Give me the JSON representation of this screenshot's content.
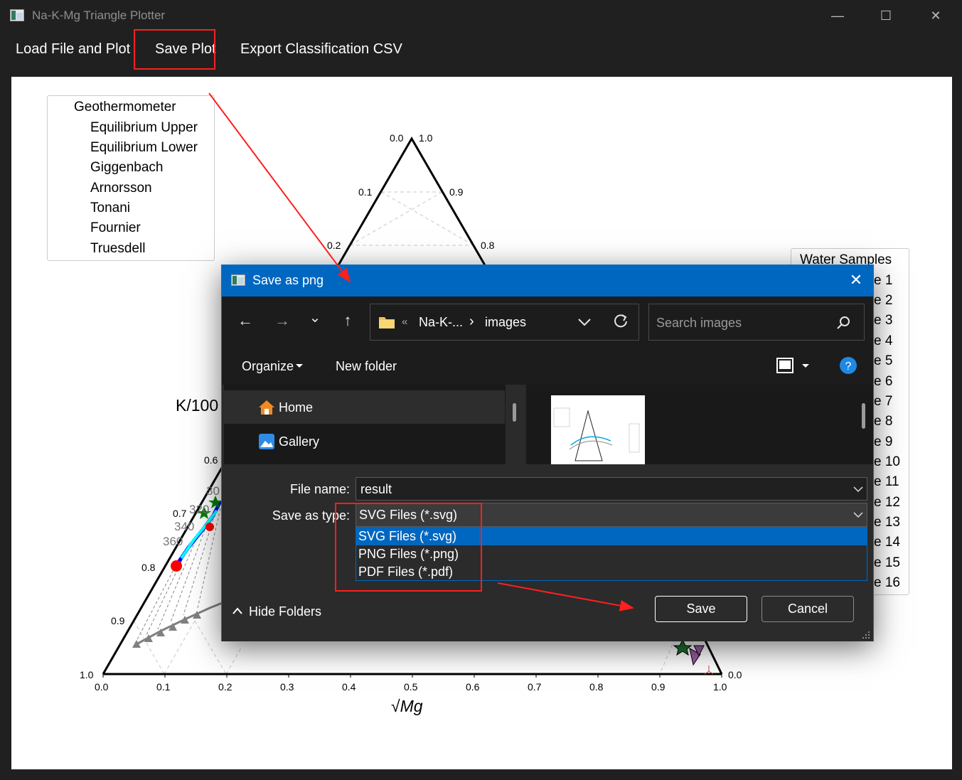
{
  "window": {
    "title": "Na-K-Mg Triangle Plotter",
    "controls": {
      "minimize": "—",
      "maximize": "☐",
      "close": "✕"
    }
  },
  "menu": {
    "load": "Load File and Plot",
    "save": "Save Plot",
    "export": "Export Classification CSV"
  },
  "legend": {
    "title": "Geothermometer",
    "items": [
      {
        "label": "Equilibrium Upper",
        "color": "#808080",
        "marker": "circle"
      },
      {
        "label": "Equilibrium Lower",
        "color": "#808080",
        "marker": "triangle-up"
      },
      {
        "label": "Giggenbach",
        "color": "#000000",
        "marker": "triangle-up"
      },
      {
        "label": "Arnorsson",
        "color": "#ff0000",
        "marker": "circle"
      },
      {
        "label": "Tonani",
        "color": "#008000",
        "marker": "star"
      },
      {
        "label": "Fournier",
        "color": "#0000ff",
        "marker": "triangle-right"
      },
      {
        "label": "Truesdell",
        "color": "#00ffff",
        "marker": "triangle-left"
      }
    ]
  },
  "samples": {
    "title": "Water Samples",
    "items": [
      "e 1",
      "e 2",
      "e 3",
      "e 4",
      "e 5",
      "e 6",
      "e 7",
      "e 8",
      "e 9",
      "e 10",
      "e 11",
      "e 12",
      "e 13",
      "e 14",
      "e 15",
      "e 16"
    ]
  },
  "plot": {
    "xlabel": "√Mg",
    "left_axis_label": "K/100",
    "bottom_ticks": [
      "0.0",
      "0.1",
      "0.2",
      "0.3",
      "0.4",
      "0.5",
      "0.6",
      "0.7",
      "0.8",
      "0.9",
      "1.0"
    ],
    "apex_left": "0.0",
    "apex_right": "1.0",
    "left_side_ticks": [
      "0.1",
      "0.2",
      "0.6",
      "0.7",
      "0.8",
      "0.9",
      "1.0"
    ],
    "right_side_ticks": [
      "0.9",
      "0.8"
    ],
    "bottom_right_tick": "0.0",
    "temperature_labels": [
      "30",
      "320",
      "340",
      "360"
    ]
  },
  "dialog": {
    "title": "Save as png",
    "close": "✕",
    "nav": {
      "back": "←",
      "forward": "→",
      "recent": "⌄",
      "up": "↑"
    },
    "breadcrumb": {
      "overflow": "«",
      "folder1": "Na-K-...",
      "separator": "›",
      "folder2": "images"
    },
    "search_placeholder": "Search images",
    "organize": "Organize",
    "new_folder": "New folder",
    "nav_pane": [
      "Home",
      "Gallery"
    ],
    "file_name_label": "File name:",
    "file_name_value": "result",
    "save_type_label": "Save as type:",
    "save_type_value": "SVG Files (*.svg)",
    "type_options": [
      "SVG Files (*.svg)",
      "PNG Files (*.png)",
      "PDF Files (*.pdf)"
    ],
    "hide_folders": "Hide Folders",
    "save": "Save",
    "cancel": "Cancel"
  },
  "colors": {
    "accent": "#0067c0",
    "highlight": "#ff1f1f"
  }
}
